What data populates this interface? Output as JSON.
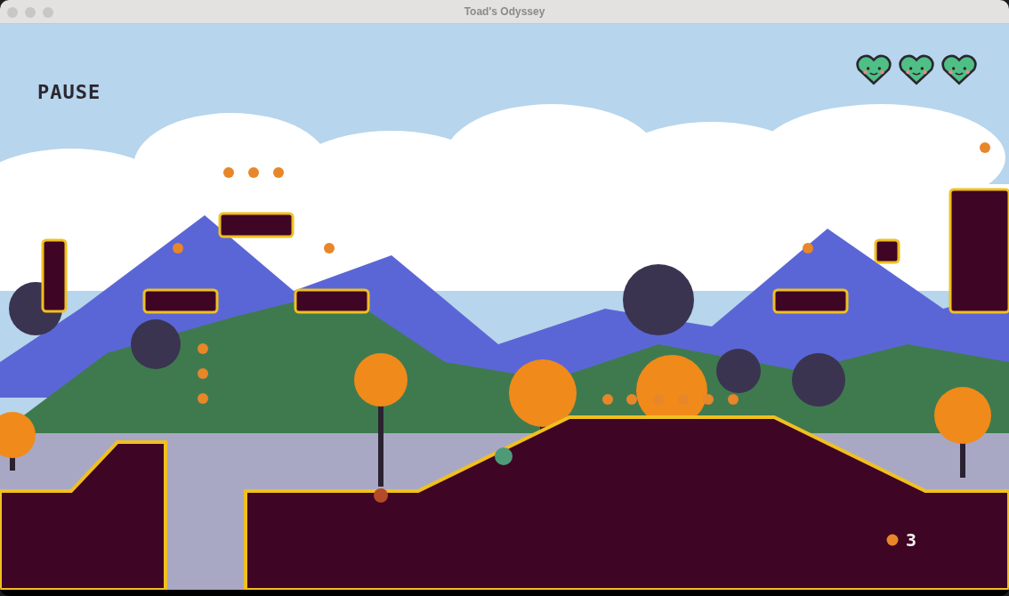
{
  "window": {
    "title": "Toad's Odyssey"
  },
  "hud": {
    "pause_label": "PAUSE",
    "coin_count": "3",
    "lives": [
      {
        "filled": true
      },
      {
        "filled": true
      },
      {
        "filled": true
      }
    ]
  }
}
